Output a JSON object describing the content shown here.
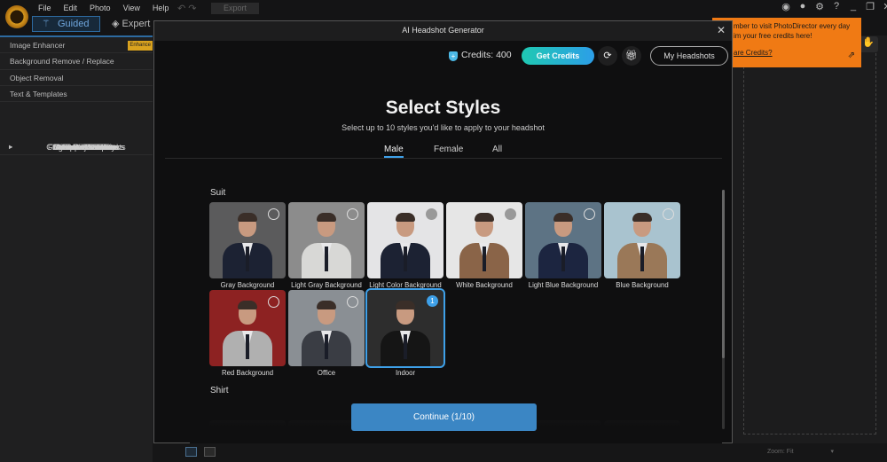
{
  "app": {
    "menu": [
      "File",
      "Edit",
      "Photo",
      "View",
      "Help"
    ],
    "export_label": "Export",
    "guided_label": "Guided",
    "expert_label": "Expert"
  },
  "sidebar": {
    "items": [
      {
        "label": "Image Enhancer",
        "badge": "Enhance"
      },
      {
        "label": "Background Remove / Replace"
      },
      {
        "label": "Object Removal"
      },
      {
        "label": "Basic Tools",
        "expandable": true
      },
      {
        "label": "Color Adjustments",
        "expandable": true
      },
      {
        "label": "Text & Templates"
      },
      {
        "label": "People Beautifier",
        "expandable": true
      },
      {
        "label": "Generative AI / Effects",
        "expandable": true
      },
      {
        "label": "AI Improvements",
        "expandable": true
      },
      {
        "label": "Photo Effects",
        "expandable": true
      },
      {
        "label": "Light / Lens Effects",
        "expandable": true
      },
      {
        "label": "Animation Effects",
        "expandable": true
      },
      {
        "label": "Extract / Compose",
        "expandable": true
      },
      {
        "label": "Stickers / Overlays",
        "expandable": true
      },
      {
        "label": "Frames / Watermarks",
        "expandable": true
      },
      {
        "label": "360° Photo Editor",
        "expandable": true
      }
    ]
  },
  "tooltip": {
    "line1": "mber to visit PhotoDirector every day",
    "line2": "im your free credits here!",
    "link": "are Credits?"
  },
  "bottom": {
    "zoom_label": "Zoom:",
    "zoom_value": "Fit"
  },
  "modal": {
    "title": "AI Headshot Generator",
    "credits": "Credits: 400",
    "get_credits": "Get Credits",
    "my_headshots": "My Headshots",
    "heading": "Select Styles",
    "subheading": "Select up to 10 styles you'd like to apply to your headshot",
    "tabs": [
      "Male",
      "Female",
      "All"
    ],
    "active_tab": "Male",
    "sections": [
      "Suit",
      "Shirt"
    ],
    "cards": [
      {
        "label": "Gray Background",
        "bg": "#5b5b5c",
        "suit": "#1c2233",
        "selected": false
      },
      {
        "label": "Light Gray Background",
        "bg": "#8c8c8c",
        "suit": "#d8d8d6",
        "selected": false
      },
      {
        "label": "Light Color Background",
        "bg": "#e4e4e6",
        "suit": "#1c2233",
        "selected": false
      },
      {
        "label": "White Background",
        "bg": "#e6e6e6",
        "suit": "#8a6448",
        "selected": false
      },
      {
        "label": "Light Blue Background",
        "bg": "#5d7384",
        "suit": "#1c2540",
        "selected": false
      },
      {
        "label": "Blue Background",
        "bg": "#a9c3cf",
        "suit": "#9a7858",
        "selected": false
      },
      {
        "label": "Red Background",
        "bg": "#8d2222",
        "suit": "#b0b0b0",
        "selected": false
      },
      {
        "label": "Office",
        "bg": "#8a8f94",
        "suit": "#3a3d44",
        "selected": false
      },
      {
        "label": "Indoor",
        "bg": "#2d2d2d",
        "suit": "#151515",
        "selected": true,
        "order": "1"
      }
    ],
    "continue": "Continue (1/10)"
  }
}
